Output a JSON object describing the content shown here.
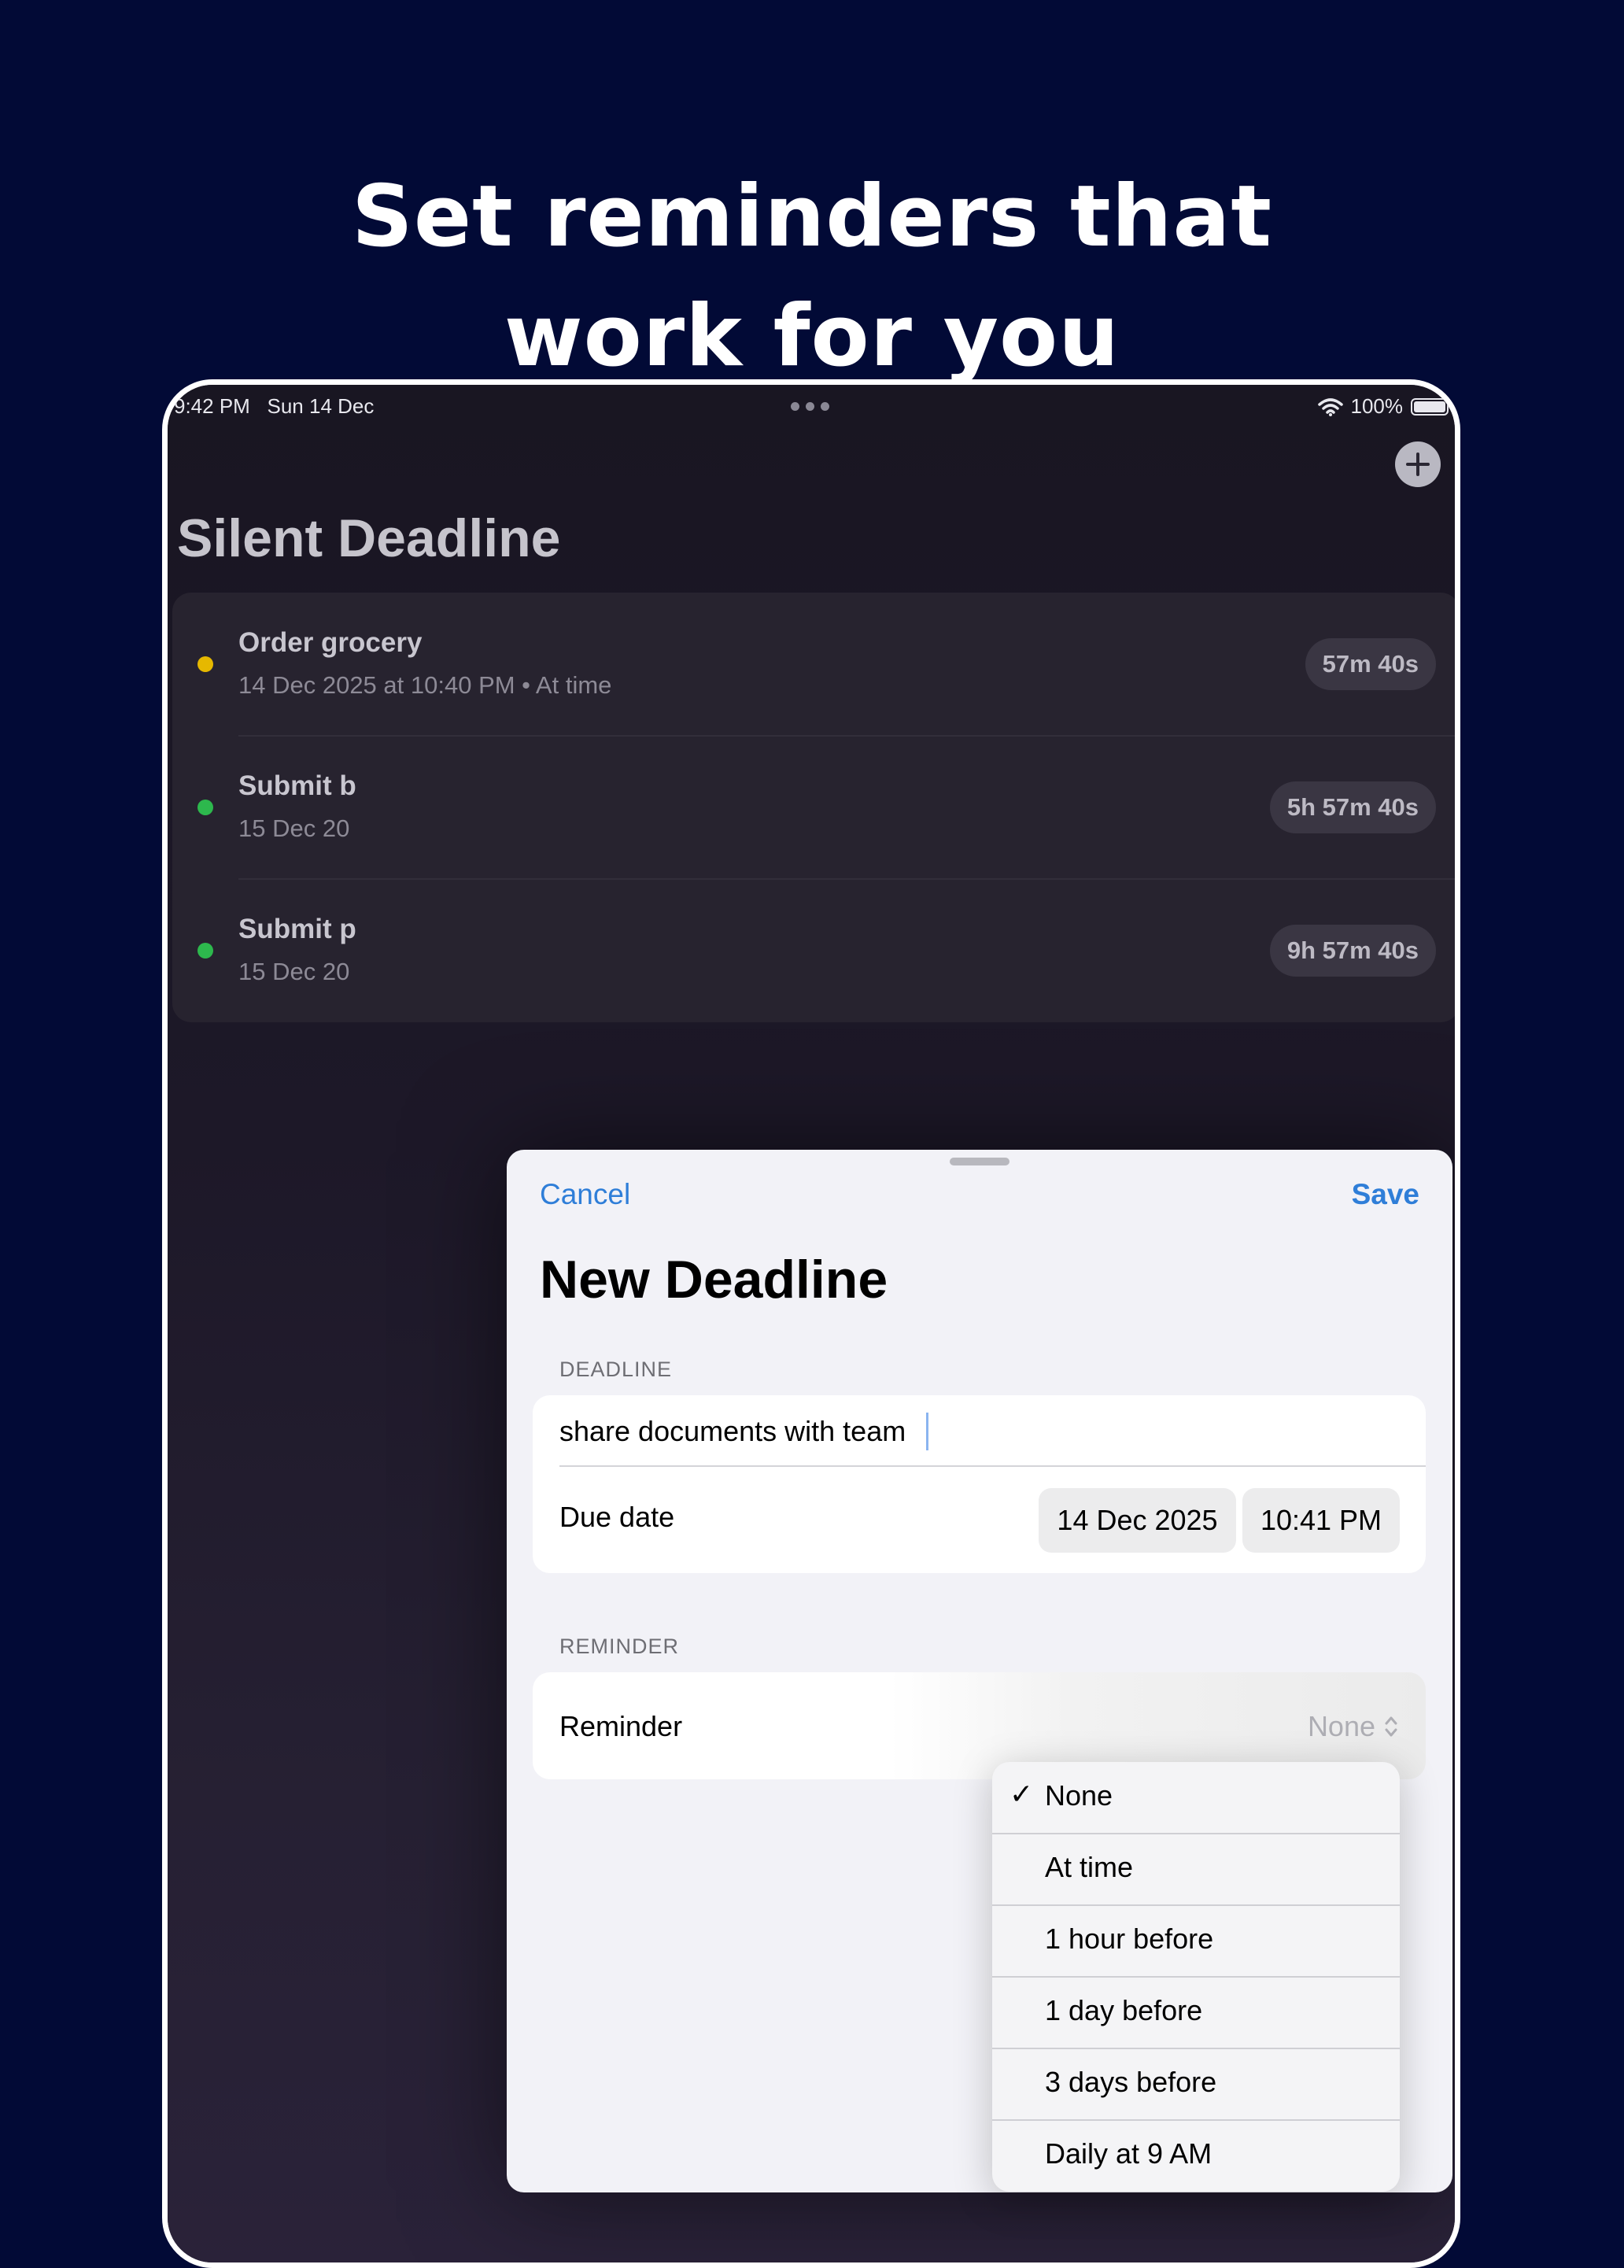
{
  "headline": {
    "line1": "Set reminders that",
    "line2": "work for you"
  },
  "status_bar": {
    "time": "9:42 PM",
    "date": "Sun 14 Dec",
    "battery": "100%",
    "wifi_icon": "wifi-icon",
    "battery_icon": "battery-icon"
  },
  "app": {
    "title": "Silent Deadline",
    "add_icon": "plus-icon"
  },
  "list": {
    "items": [
      {
        "title": "Order grocery",
        "subtitle": "14 Dec 2025 at 10:40 PM • At time",
        "countdown": "57m 40s",
        "dot_color": "#e6b800"
      },
      {
        "title": "Submit b",
        "subtitle": "15 Dec 20",
        "countdown": "5h 57m 40s",
        "dot_color": "#2db84d"
      },
      {
        "title": "Submit p",
        "subtitle": "15 Dec 20",
        "countdown": "9h 57m 40s",
        "dot_color": "#2db84d"
      }
    ]
  },
  "sheet": {
    "cancel_label": "Cancel",
    "save_label": "Save",
    "title": "New Deadline",
    "deadline_header": "DEADLINE",
    "name_value": "share documents with team",
    "due_date_label": "Due date",
    "due_date_value": "14 Dec 2025",
    "due_time_value": "10:41 PM",
    "reminder_header": "REMINDER",
    "reminder_label": "Reminder",
    "reminder_value": "None",
    "accent_color": "#2f7ed8"
  },
  "reminder_menu": {
    "selected": "None",
    "options": [
      "None",
      "At time",
      "1 hour before",
      "1 day before",
      "3 days before",
      "Daily at 9 AM"
    ]
  }
}
